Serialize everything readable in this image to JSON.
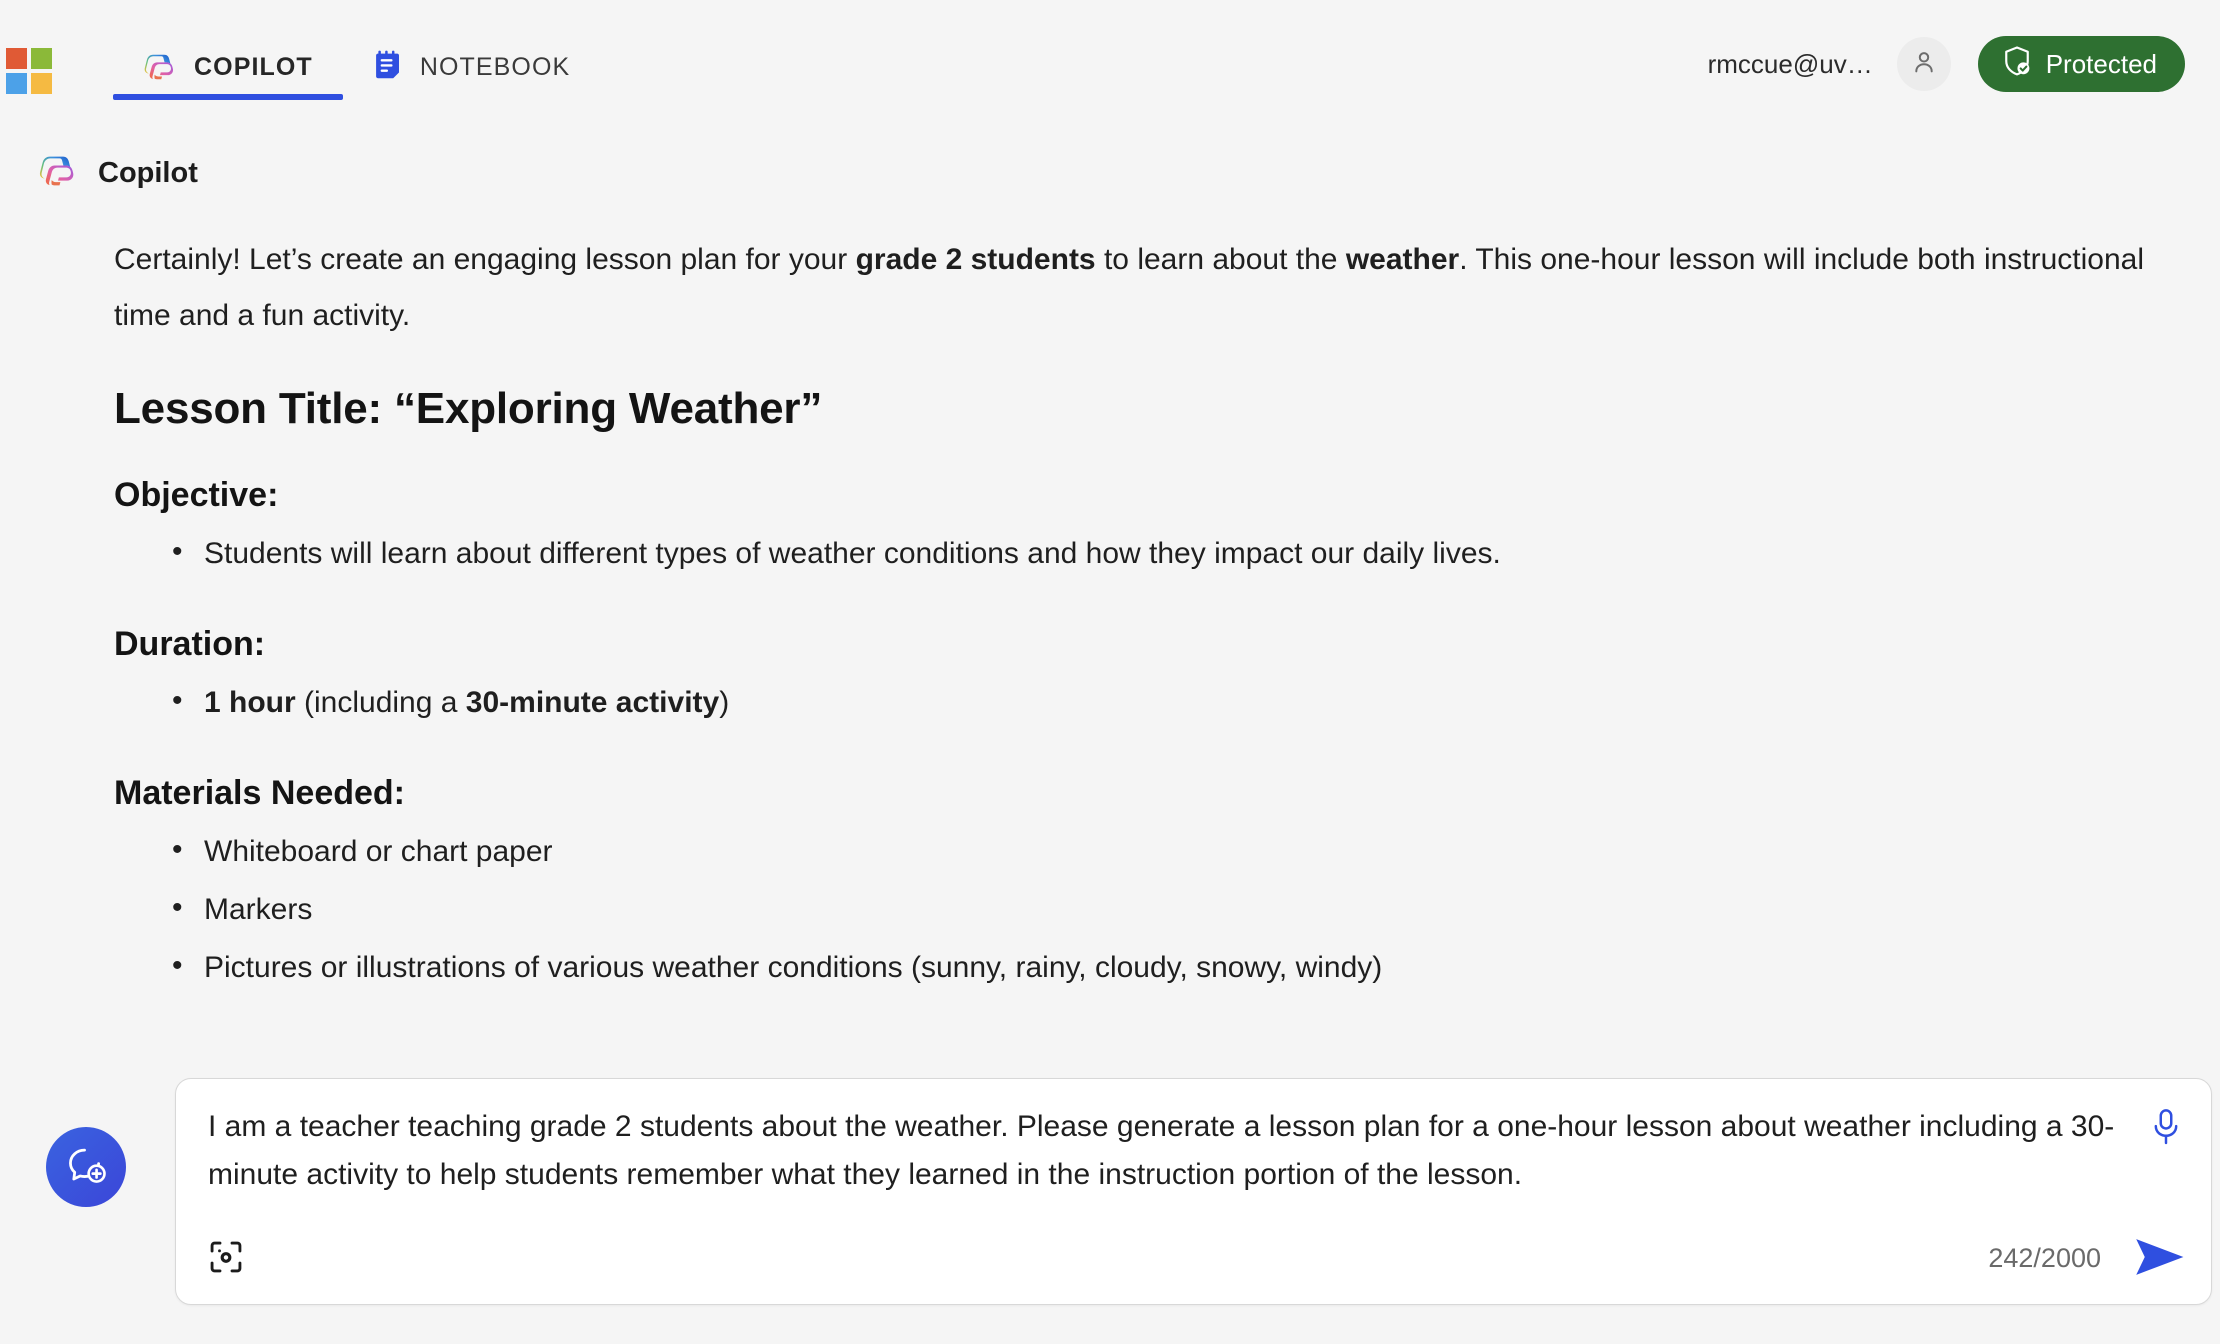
{
  "topbar": {
    "ms_logo_name": "microsoft-logo",
    "tabs": [
      {
        "label": "COPILOT",
        "icon": "copilot-icon",
        "active": true
      },
      {
        "label": "NOTEBOOK",
        "icon": "notebook-icon",
        "active": false
      }
    ],
    "account_email": "rmccue@uv…",
    "avatar_icon": "person-icon",
    "protected_label": "Protected",
    "protected_icon": "shield-check-icon",
    "colors": {
      "protected_green": "#2e7031",
      "tab_underline_blue": "#2f4fe0",
      "accent_blue": "#2f4fe0"
    }
  },
  "conversation": {
    "assistant_name": "Copilot",
    "assistant_icon": "copilot-icon",
    "intro": {
      "part1": "Certainly! Let’s create an engaging lesson plan for your ",
      "bold1": "grade 2 students",
      "part2": " to learn about the ",
      "bold2": "weather",
      "part3": ". This one-hour lesson will include both instructional time and a fun activity."
    },
    "lesson_title": "Lesson Title: “Exploring Weather”",
    "sections": [
      {
        "heading": "Objective:",
        "items": [
          {
            "text": "Students will learn about different types of weather conditions and how they impact our daily lives."
          }
        ]
      },
      {
        "heading": "Duration:",
        "items": [
          {
            "bold_lead": "1 hour",
            "mid": " (including a ",
            "bold_tail": "30-minute activity",
            "tail": ")"
          }
        ]
      },
      {
        "heading": "Materials Needed:",
        "items": [
          {
            "text": "Whiteboard or chart paper"
          },
          {
            "text": "Markers"
          },
          {
            "text": "Pictures or illustrations of various weather conditions (sunny, rainy, cloudy, snowy, windy)"
          }
        ]
      }
    ]
  },
  "composer": {
    "new_chat_icon": "new-chat-icon",
    "value": "I am a teacher teaching grade 2 students about the weather. Please generate a lesson plan for a one-hour lesson about weather including a 30-minute activity to help students remember what they learned in the instruction portion of the lesson.",
    "mic_icon": "microphone-icon",
    "scan_icon": "scan-camera-icon",
    "char_count": "242/2000",
    "send_icon": "send-icon"
  }
}
